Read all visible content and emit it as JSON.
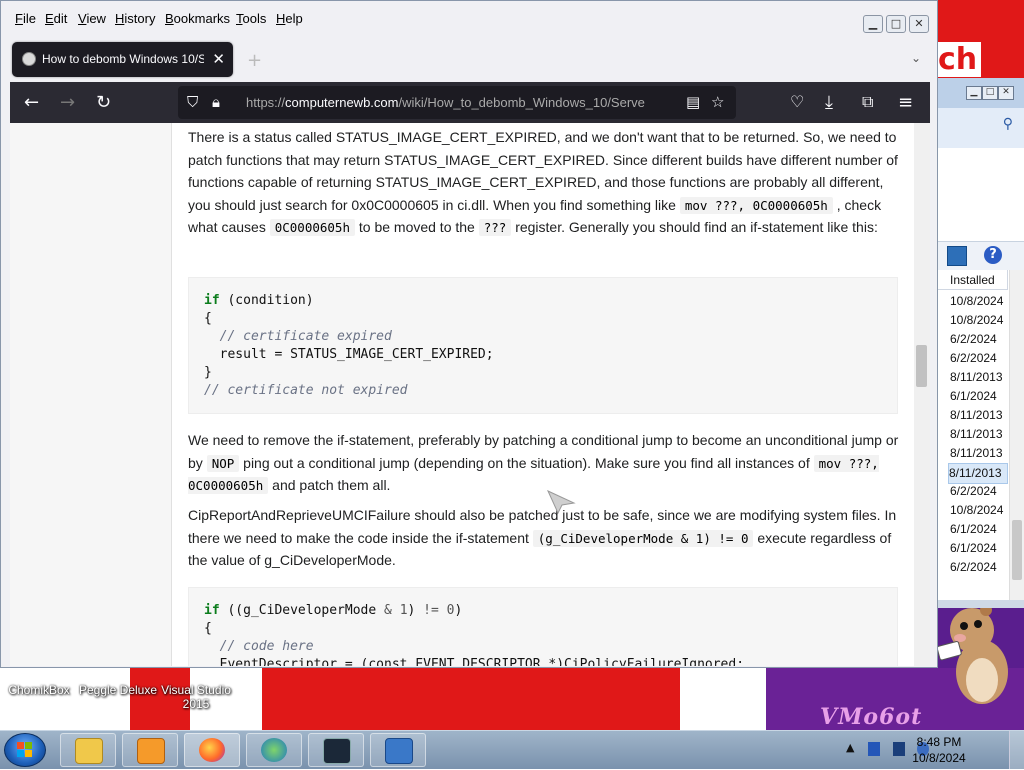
{
  "desktop": {
    "logo_text": "ch",
    "vm_logo": "VMo6ot",
    "icons": [
      {
        "label": "ChomikBox"
      },
      {
        "label": "Peggle Deluxe"
      },
      {
        "label": "Visual Studio 2015"
      }
    ]
  },
  "back_window": {
    "column_header": "Installed",
    "dates": [
      "10/8/2024",
      "10/8/2024",
      "6/2/2024",
      "6/2/2024",
      "8/11/2013",
      "6/1/2024",
      "8/11/2013",
      "8/11/2013",
      "8/11/2013",
      "8/11/2013",
      "6/2/2024",
      "10/8/2024",
      "6/1/2024",
      "6/1/2024",
      "6/2/2024"
    ],
    "selected_index": 9
  },
  "browser": {
    "menu": [
      "File",
      "Edit",
      "View",
      "History",
      "Bookmarks",
      "Tools",
      "Help"
    ],
    "menu_access_keys": [
      "F",
      "E",
      "V",
      "H",
      "B",
      "T",
      "H"
    ],
    "tab_title": "How to debomb Windows 10/S",
    "url_prefix": "https://",
    "url_host": "computernewb.com",
    "url_path": "/wiki/How_to_debomb_Windows_10/Serve",
    "accent_dark": "#2b2a33",
    "tab_dark": "#1c1b22"
  },
  "article": {
    "p1": {
      "a": "There is a status called STATUS_IMAGE_CERT_EXPIRED, and we don't want that to be returned. So, we need to patch functions that may return STATUS_IMAGE_CERT_EXPIRED. Since different builds have different number of functions capable of returning STATUS_IMAGE_CERT_EXPIRED, and those functions are probably all different, you should just search for 0x0C0000605 in ci.dll. When you find something like ",
      "code1": "mov ???, 0C0000605h",
      "b": " , check what causes ",
      "code2": "0C0000605h",
      "c": " to be moved to the ",
      "code3": "???",
      "d": " register. Generally you should find an if-statement like this:"
    },
    "code_block_1": {
      "line1_kw": "if",
      "line1_rest": " (condition)",
      "line2": "{",
      "line3": "  // certificate expired",
      "line4": "  result = STATUS_IMAGE_CERT_EXPIRED;",
      "line5": "}",
      "line6": "// certificate not expired"
    },
    "p2": {
      "a": "We need to remove the if-statement, preferably by patching a conditional jump to become an unconditional jump or by ",
      "code1": "NOP",
      "b": " ping out a conditional jump (depending on the situation). Make sure you find all instances of ",
      "code2": "mov ???, 0C0000605h",
      "c": " and patch them all."
    },
    "p3": {
      "a": "CipReportAndReprieveUMCIFailure should also be patched just to be safe, since we are modifying system files. In there we need to make the code inside the if-statement ",
      "code1": "(g_CiDeveloperMode & 1) != 0",
      "b": " execute regardless of the value of g_CiDeveloperMode."
    },
    "code_block_2": {
      "line1_kw": "if",
      "line1_a": " ((g_CiDeveloperMode ",
      "line1_amp": "&",
      "line1_b": " ",
      "line1_one": "1",
      "line1_c": ") ",
      "line1_ne": "!=",
      "line1_d": " ",
      "line1_zero": "0",
      "line1_e": ")",
      "line2": "{",
      "line3": "  // code here",
      "line4": "  EventDescriptor = (const EVENT_DESCRIPTOR *)CiPolicyFailureIgnored;"
    }
  },
  "taskbar": {
    "time": "8:48 PM",
    "date": "10/8/2024"
  }
}
